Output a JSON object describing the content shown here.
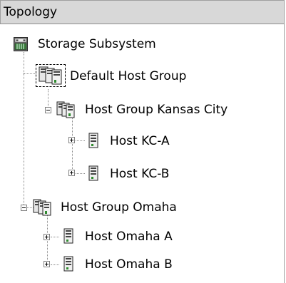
{
  "panel": {
    "title": "Topology"
  },
  "tree": {
    "root": {
      "label": "Storage Subsystem",
      "icon": "storage-subsystem-icon"
    },
    "default_group": {
      "label": "Default Host Group",
      "icon": "host-group-icon"
    },
    "group_kc": {
      "label": "Host Group Kansas City",
      "icon": "host-group-icon",
      "hosts": [
        {
          "label": "Host KC-A",
          "icon": "host-icon"
        },
        {
          "label": "Host KC-B",
          "icon": "host-icon"
        }
      ]
    },
    "group_omaha": {
      "label": "Host Group Omaha",
      "icon": "host-group-icon",
      "hosts": [
        {
          "label": "Host Omaha A",
          "icon": "host-icon"
        },
        {
          "label": "Host Omaha B",
          "icon": "host-icon"
        }
      ]
    }
  }
}
